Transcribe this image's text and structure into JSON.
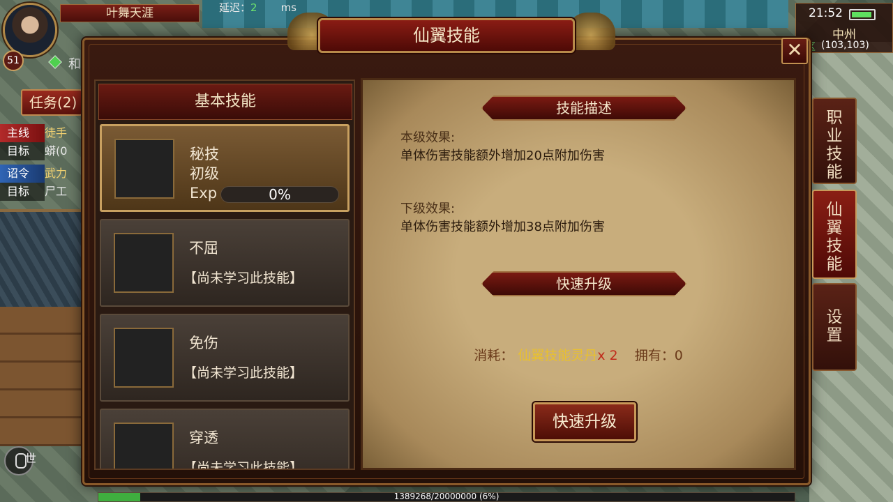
{
  "hud": {
    "player_name": "叶舞天涯",
    "level": "51",
    "ping_label": "延迟：",
    "ping_value": "2",
    "ping_unit": "ms",
    "time": "21:52",
    "city": "中州",
    "zone": "全区",
    "coords": "(103,103)",
    "task_tab": "任务(2)",
    "quests": [
      {
        "tag": "主线",
        "text": "徒手"
      },
      {
        "label": "目标",
        "text": "蟒(0"
      },
      {
        "tag": "诏令",
        "text": "武力"
      },
      {
        "label": "目标",
        "text": "尸工"
      }
    ],
    "world_channel": "世",
    "gem_text": "和"
  },
  "dialog": {
    "title": "仙翼技能",
    "close_label": "✕",
    "left_header": "基本技能",
    "skills": [
      {
        "name": "秘技",
        "grade": "初级",
        "exp_label": "Exp",
        "exp_value": "0%",
        "exp_fraction": 0,
        "icon": "fire-burst-icon"
      },
      {
        "name": "不屈",
        "status": "【尚未学习此技能】",
        "icon": "angel-wings-icon"
      },
      {
        "name": "免伤",
        "status": "【尚未学习此技能】",
        "icon": "shield-icon"
      },
      {
        "name": "穿透",
        "status": "【尚未学习此技能】",
        "icon": "pierce-icon"
      }
    ],
    "desc_header": "技能描述",
    "current_label": "本级效果:",
    "current_text": "单体伤害技能额外增加20点附加伤害",
    "next_label": "下级效果:",
    "next_text": "单体伤害技能额外增加38点附加伤害",
    "quick_header": "快速升级",
    "cost_label": "消耗：",
    "cost_item": "仙翼技能灵丹",
    "cost_mult": "x 2",
    "own_label": "拥有：",
    "own_value": "0",
    "upgrade_button": "快速升级"
  },
  "side_tabs": [
    {
      "chars": [
        "职",
        "业",
        "技",
        "能"
      ],
      "selected": false
    },
    {
      "chars": [
        "仙",
        "翼",
        "技",
        "能"
      ],
      "selected": true
    },
    {
      "chars": [
        "设",
        "置"
      ],
      "selected": false
    }
  ],
  "xp": {
    "text": "1389268/20000000 (6%)",
    "fraction": 0.06
  }
}
